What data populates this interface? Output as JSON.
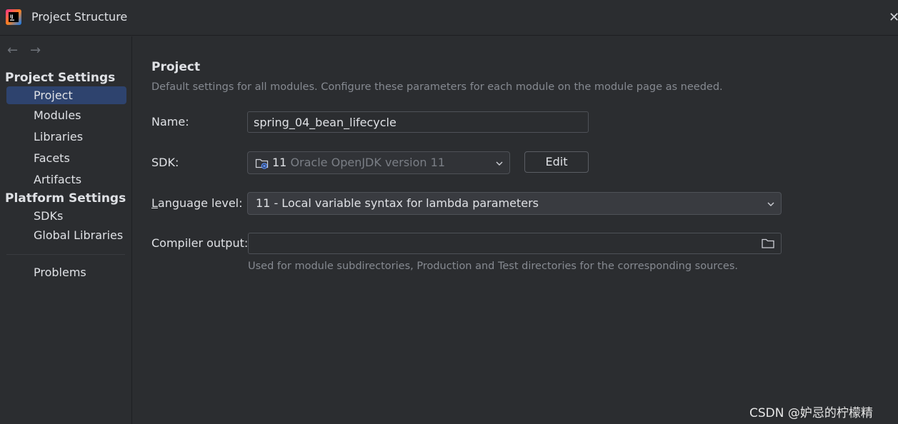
{
  "window": {
    "title": "Project Structure",
    "close_glyph": "✕"
  },
  "nav": {
    "back_glyph": "←",
    "forward_glyph": "→"
  },
  "sidebar": {
    "project_settings_title": "Project Settings",
    "project_items": [
      "Project",
      "Modules",
      "Libraries",
      "Facets",
      "Artifacts"
    ],
    "platform_settings_title": "Platform Settings",
    "platform_items": [
      "SDKs",
      "Global Libraries"
    ],
    "problems_label": "Problems",
    "active_item": "Project"
  },
  "main": {
    "title": "Project",
    "description": "Default settings for all modules. Configure these parameters for each module on the module page as needed.",
    "name_label": "Name:",
    "name_value": "spring_04_bean_lifecycle",
    "sdk_label": "SDK:",
    "sdk_version": "11",
    "sdk_description": "Oracle OpenJDK version 11",
    "edit_label": "Edit",
    "language_label_first": "L",
    "language_label_rest": "anguage level:",
    "language_value": "11 - Local variable syntax for lambda parameters",
    "compiler_label": "Compiler output:",
    "compiler_value": "",
    "compiler_hint": "Used for module subdirectories, Production and Test directories for the corresponding sources."
  },
  "watermark": "CSDN @妒忌的柠檬精",
  "colors": {
    "accent": "#3574f0",
    "selection": "#2e436e",
    "background": "#2b2d30"
  }
}
